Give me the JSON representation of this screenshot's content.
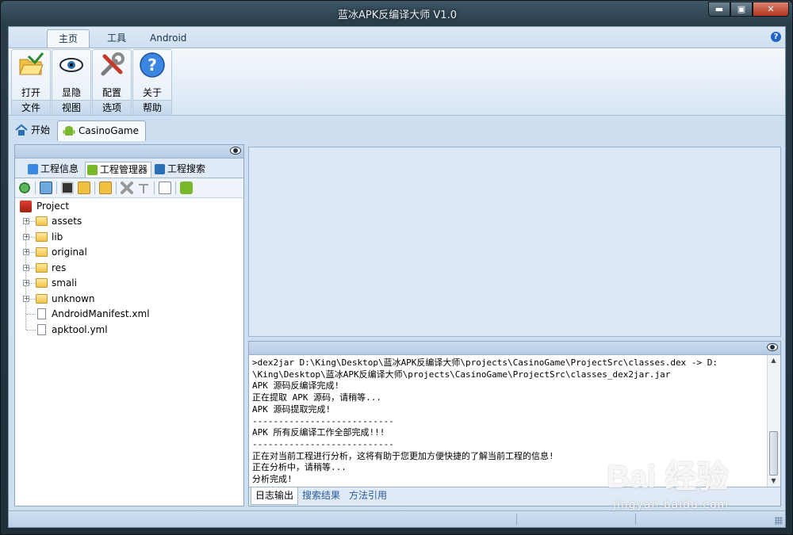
{
  "window": {
    "title": "蓝冰APK反编译大师 V1.0",
    "min_glyph": "▬",
    "max_glyph": "▣",
    "close_glyph": "✕"
  },
  "ribbon": {
    "tabs": [
      {
        "label": "主页",
        "active": true
      },
      {
        "label": "工具"
      },
      {
        "label": "Android"
      }
    ],
    "help_glyph": "?",
    "groups": [
      {
        "button": "打开",
        "group": "文件",
        "icon": "folder-open-icon"
      },
      {
        "button": "显隐",
        "group": "视图",
        "icon": "eye-icon"
      },
      {
        "button": "配置",
        "group": "选项",
        "icon": "tools-icon"
      },
      {
        "button": "关于",
        "group": "帮助",
        "icon": "help-icon"
      }
    ]
  },
  "doc_tabs": [
    {
      "label": "开始",
      "icon": "home-icon"
    },
    {
      "label": "CasinoGame",
      "icon": "android-icon",
      "active": true
    }
  ],
  "left_panel": {
    "tabs": [
      {
        "label": "工程信息",
        "icon": "info-icon"
      },
      {
        "label": "工程管理器",
        "icon": "android-icon",
        "active": true
      },
      {
        "label": "工程搜索",
        "icon": "search-icon"
      }
    ],
    "tree": {
      "root": "Project",
      "items": [
        {
          "label": "assets",
          "type": "folder"
        },
        {
          "label": "lib",
          "type": "folder"
        },
        {
          "label": "original",
          "type": "folder"
        },
        {
          "label": "res",
          "type": "folder"
        },
        {
          "label": "smali",
          "type": "folder"
        },
        {
          "label": "unknown",
          "type": "folder"
        },
        {
          "label": "AndroidManifest.xml",
          "type": "file"
        },
        {
          "label": "apktool.yml",
          "type": "file"
        }
      ]
    }
  },
  "log": {
    "lines": [
      ">dex2jar D:\\King\\Desktop\\蓝冰APK反编译大师\\projects\\CasinoGame\\ProjectSrc\\classes.dex -> D:",
      "\\King\\Desktop\\蓝冰APK反编译大师\\projects\\CasinoGame\\ProjectSrc\\classes_dex2jar.jar",
      "APK 源码反编译完成!",
      "正在提取 APK 源码，请稍等...",
      "APK 源码提取完成!",
      "---------------------------",
      "APK 所有反编译工作全部完成!!!",
      "---------------------------",
      "正在对当前工程进行分析，这将有助于您更加方便快捷的了解当前工程的信息!",
      "正在分析中，请稍等...",
      "分析完成!"
    ],
    "tabs": [
      {
        "label": "日志输出",
        "active": true
      },
      {
        "label": "搜索结果"
      },
      {
        "label": "方法引用"
      }
    ]
  },
  "watermark": {
    "logo_text": "Bai  经验",
    "url": "jingyan.baidu.com"
  }
}
